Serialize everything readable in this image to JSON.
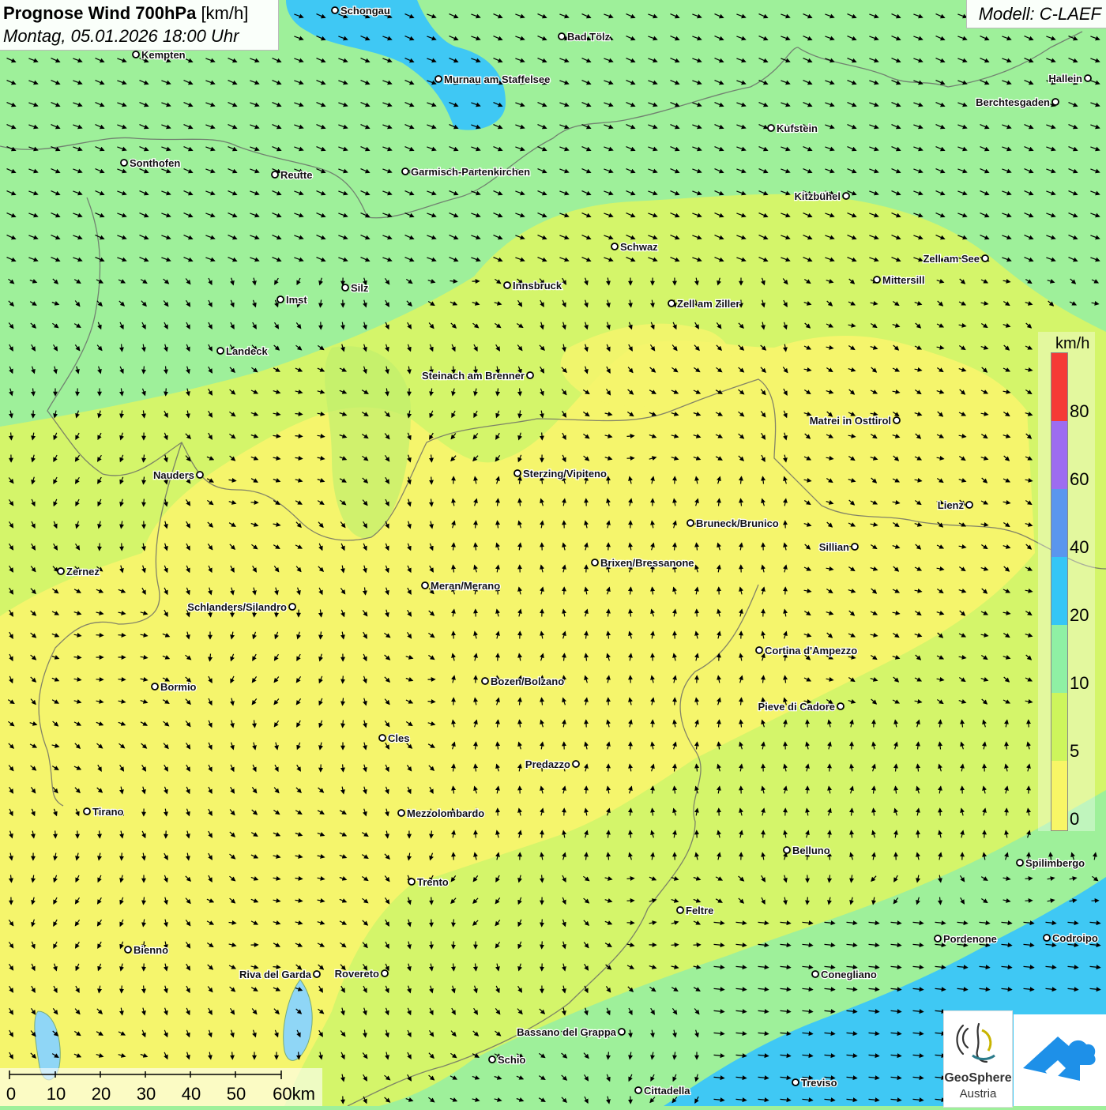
{
  "header": {
    "title": "Prognose Wind 700hPa",
    "unit_suffix": "[km/h]",
    "datetime": "Montag, 05.01.2026 18:00 Uhr"
  },
  "model": {
    "label": "Modell: C-LAEF"
  },
  "legend": {
    "unit": "km/h",
    "labels": [
      "80",
      "60",
      "40",
      "20",
      "10",
      "5",
      "0"
    ],
    "bands": [
      {
        "color": "#f53a36"
      },
      {
        "color": "#9d6cf0"
      },
      {
        "color": "#5a96ee"
      },
      {
        "color": "#35c6f5"
      },
      {
        "color": "#8ff0a4"
      },
      {
        "color": "#cdf55c"
      },
      {
        "color": "#f8f666"
      }
    ]
  },
  "scale": {
    "labels": [
      "0",
      "10",
      "20",
      "30",
      "40",
      "50",
      "60km"
    ]
  },
  "logos": {
    "geosphere_name": "GeoSphere",
    "geosphere_sub": "Austria"
  },
  "colors": {
    "calm": "#f5f56c",
    "light": "#d4f56a",
    "moderate": "#9ef09a",
    "strong": "#3fc8f4"
  },
  "cities": [
    {
      "name": "Schongau"
    },
    {
      "name": "Bad Tölz"
    },
    {
      "name": "Kempten"
    },
    {
      "name": "Murnau am Staffelsee"
    },
    {
      "name": "Hallein"
    },
    {
      "name": "Berchtesgaden"
    },
    {
      "name": "Kufstein"
    },
    {
      "name": "Sonthofen"
    },
    {
      "name": "Reutte"
    },
    {
      "name": "Garmisch-Partenkirchen"
    },
    {
      "name": "Kitzbühel"
    },
    {
      "name": "Schwaz"
    },
    {
      "name": "Zell am See"
    },
    {
      "name": "Innsbruck"
    },
    {
      "name": "Silz"
    },
    {
      "name": "Mittersill"
    },
    {
      "name": "Imst"
    },
    {
      "name": "Zell am Ziller"
    },
    {
      "name": "Landeck"
    },
    {
      "name": "Steinach am Brenner"
    },
    {
      "name": "Matrei in Osttirol"
    },
    {
      "name": "Nauders"
    },
    {
      "name": "Sterzing/Vipiteno"
    },
    {
      "name": "Lienz"
    },
    {
      "name": "Bruneck/Brunico"
    },
    {
      "name": "Sillian"
    },
    {
      "name": "Brixen/Bressanone"
    },
    {
      "name": "Zernez"
    },
    {
      "name": "Meran/Merano"
    },
    {
      "name": "Schlanders/Silandro"
    },
    {
      "name": "Cortina d'Ampezzo"
    },
    {
      "name": "Bozen/Bolzano"
    },
    {
      "name": "Bormio"
    },
    {
      "name": "Pieve di Cadore"
    },
    {
      "name": "Cles"
    },
    {
      "name": "Predazzo"
    },
    {
      "name": "Tirano"
    },
    {
      "name": "Mezzolombardo"
    },
    {
      "name": "Belluno"
    },
    {
      "name": "Spilimbergo"
    },
    {
      "name": "Trento"
    },
    {
      "name": "Feltre"
    },
    {
      "name": "Pordenone"
    },
    {
      "name": "Codroipo"
    },
    {
      "name": "Bienno"
    },
    {
      "name": "Riva del Garda"
    },
    {
      "name": "Rovereto"
    },
    {
      "name": "Conegliano"
    },
    {
      "name": "Bassano del Grappa"
    },
    {
      "name": "Schio"
    },
    {
      "name": "Treviso"
    },
    {
      "name": "Cittadella"
    }
  ]
}
